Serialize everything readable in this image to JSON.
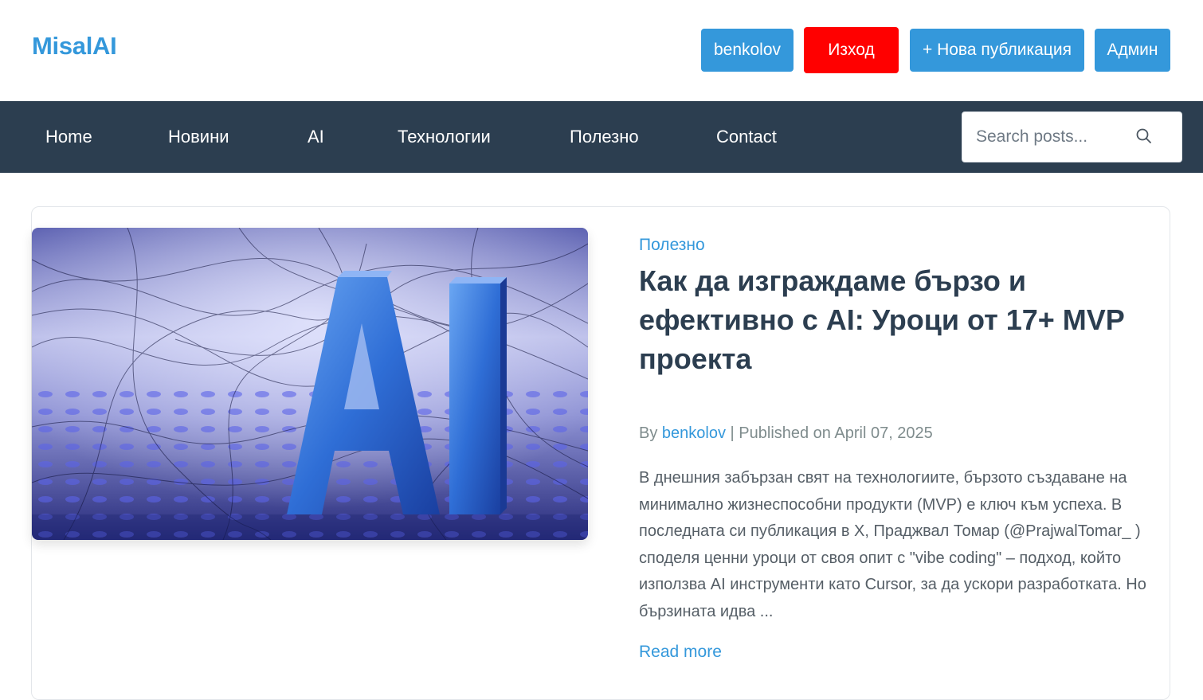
{
  "header": {
    "logo": "MisalAI",
    "user_button": "benkolov",
    "logout_button": "Изход",
    "new_post_button": "+ Нова публикация",
    "admin_button": "Админ"
  },
  "nav": {
    "items": [
      "Home",
      "Новини",
      "AI",
      "Технологии",
      "Полезно",
      "Contact"
    ],
    "search_placeholder": "Search posts..."
  },
  "post": {
    "category": "Полезно",
    "title": "Как да изграждаме бързо и ефективно с AI: Уроци от 17+ MVP проекта",
    "image_text": "AI",
    "meta": {
      "by": "By",
      "author": "benkolov",
      "published": "| Published on April 07, 2025"
    },
    "excerpt": "В днешния забързан свят на технологиите, бързото създаване на минимално жизнеспособни продукти (MVP) е ключ към успеха. В последната си публикация в X, Праджвал Томар (@PrajwalTomar_ ) споделя ценни уроци от своя опит с \"vibe coding\" – подход, който използва AI инструменти като Cursor, за да ускори разработката. Но бързината идва ...",
    "read_more": "Read more"
  },
  "colors": {
    "accent": "#3498db",
    "logout": "#ff0000",
    "navbar": "#2c3e50"
  }
}
